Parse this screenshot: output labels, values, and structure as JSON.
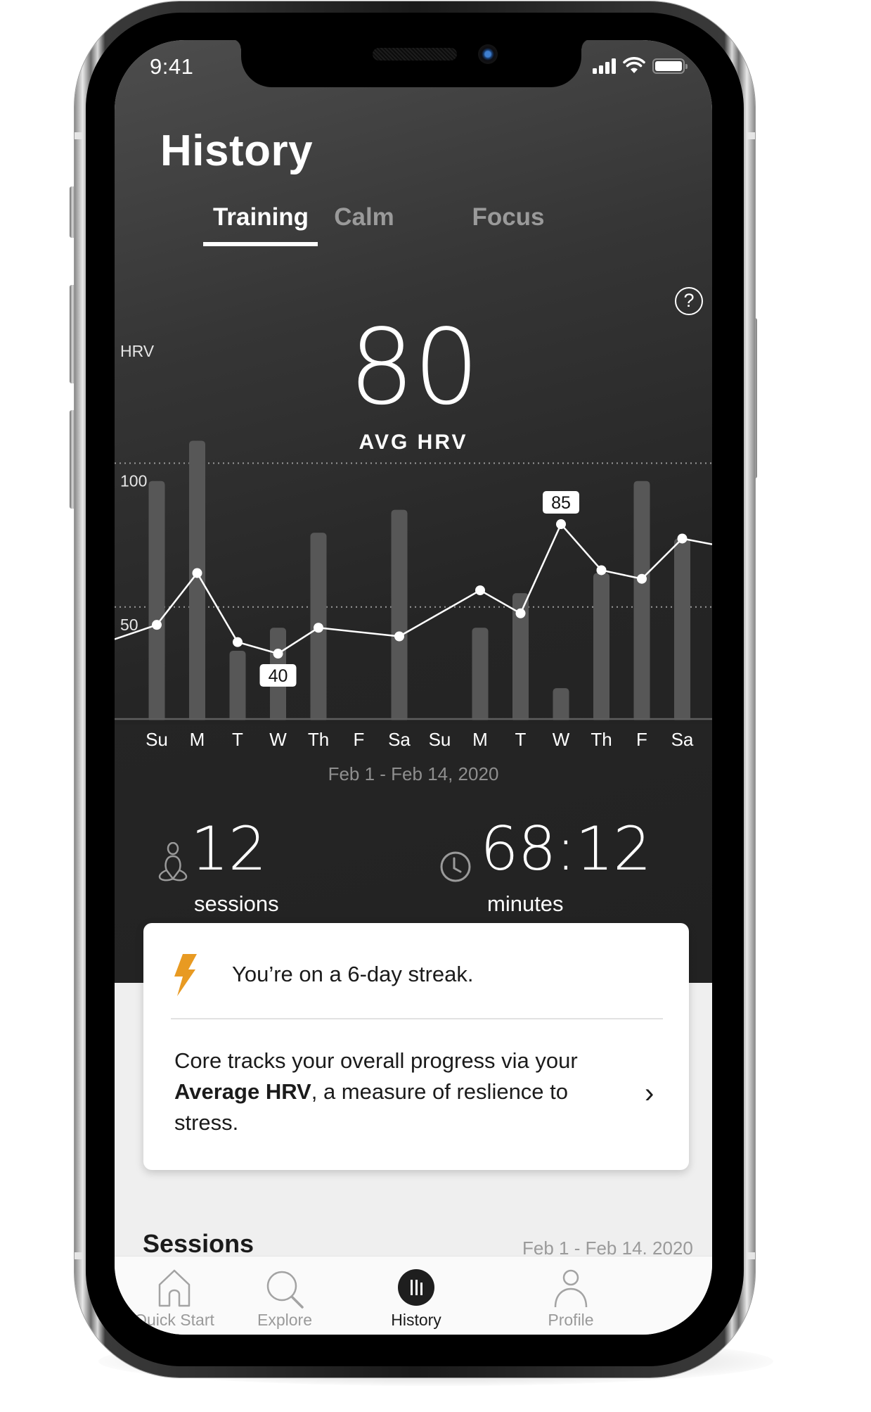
{
  "status_bar": {
    "time": "9:41",
    "signal_icon": "cellular-signal-icon",
    "wifi_icon": "wifi-icon",
    "battery_icon": "battery-icon"
  },
  "header": {
    "title": "History"
  },
  "tabs": [
    {
      "label": "Training",
      "active": true
    },
    {
      "label": "Calm",
      "active": false
    },
    {
      "label": "Focus",
      "active": false
    }
  ],
  "help_icon": "?",
  "summary": {
    "value": "80",
    "label": "AVG HRV"
  },
  "chart_data": {
    "type": "bar+line",
    "title": "",
    "ylabel": "HRV",
    "yticks": [
      100,
      50
    ],
    "ylim": [
      18,
      114
    ],
    "categories": [
      "Su",
      "M",
      "T",
      "W",
      "Th",
      "F",
      "Sa",
      "Su",
      "M",
      "T",
      "W",
      "Th",
      "F",
      "Sa"
    ],
    "series": [
      {
        "name": "bars",
        "type": "bar",
        "values": [
          100,
          114,
          41,
          49,
          82,
          null,
          90,
          null,
          49,
          61,
          28,
          68,
          100,
          80
        ]
      },
      {
        "name": "HRV",
        "type": "line",
        "values": [
          50,
          68,
          44,
          40,
          49,
          null,
          46,
          null,
          62,
          54,
          85,
          69,
          66,
          80
        ],
        "lead_in": 45,
        "trail_out": 78
      }
    ],
    "annotations": [
      {
        "index": 3,
        "label": "40",
        "position": "below"
      },
      {
        "index": 10,
        "label": "85",
        "position": "above"
      }
    ],
    "gridlines": "dotted",
    "date_range": "Feb 1 - Feb 14, 2020"
  },
  "stats": [
    {
      "icon": "meditation-icon",
      "value": "12",
      "unit": "sessions"
    },
    {
      "icon": "clock-icon",
      "value": "68:12",
      "unit": "minutes"
    }
  ],
  "streak_card": {
    "icon": "lightning-bolt-icon",
    "icon_color": "#e89a22",
    "streak_text": "You’re on a 6-day streak.",
    "body_prefix": "Core tracks your overall progress via your ",
    "body_bold": "Average HRV",
    "body_suffix": ", a measure of reslience to stress.",
    "chevron": "›"
  },
  "sessions_section": {
    "title": "Sessions",
    "date_range": "Feb 1 - Feb 14. 2020"
  },
  "nav": [
    {
      "label": "Quick Start",
      "icon": "home-icon",
      "active": false
    },
    {
      "label": "Explore",
      "icon": "search-icon",
      "active": false
    },
    {
      "label": "History",
      "icon": "history-icon",
      "active": true
    },
    {
      "label": "Profile",
      "icon": "profile-icon",
      "active": false
    }
  ]
}
